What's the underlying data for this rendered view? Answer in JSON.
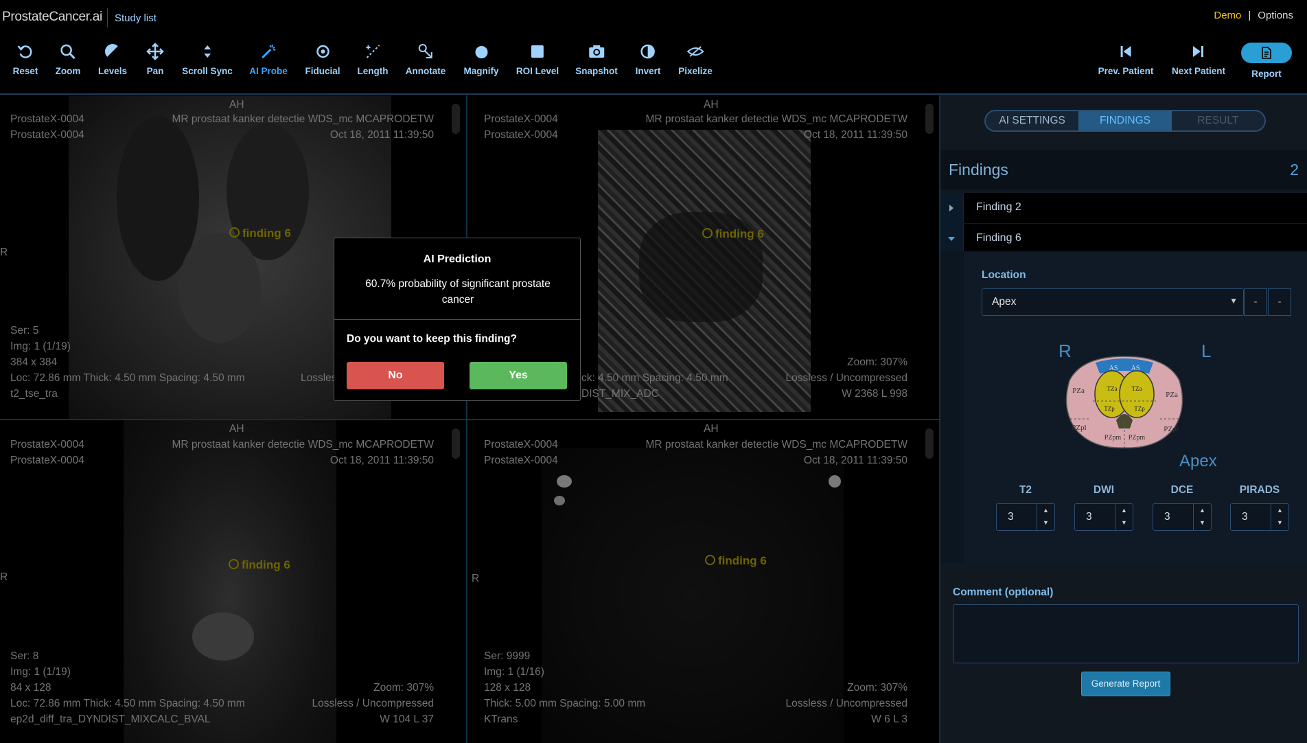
{
  "header": {
    "brand": "ProstateCancer.ai",
    "study_list": "Study list",
    "demo": "Demo",
    "separator": "|",
    "options": "Options"
  },
  "toolbar": {
    "reset": "Reset",
    "zoom": "Zoom",
    "levels": "Levels",
    "pan": "Pan",
    "scroll_sync": "Scroll Sync",
    "ai_probe": "AI Probe",
    "fiducial": "Fiducial",
    "length": "Length",
    "annotate": "Annotate",
    "magnify": "Magnify",
    "roi_level": "ROI Level",
    "snapshot": "Snapshot",
    "invert": "Invert",
    "pixelize": "Pixelize",
    "prev_patient": "Prev. Patient",
    "next_patient": "Next Patient",
    "report": "Report"
  },
  "viewports": {
    "v1": {
      "orient_top": "AH",
      "orient_left": "R",
      "patient_1": "ProstateX-0004",
      "patient_2": "ProstateX-0004",
      "study": "MR prostaat kanker detectie WDS_mc MCAPRODETW",
      "date": "Oct 18, 2011 11:39:50",
      "ser": "Ser: 5",
      "img": "Img: 1 (1/19)",
      "dims": "384 x 384",
      "loc": "Loc: 72.86 mm Thick: 4.50 mm Spacing: 4.50 mm",
      "desc": "t2_tse_tra",
      "lossless": "Lossless / Uncompressed",
      "finding": "finding 6"
    },
    "v2": {
      "orient_top": "AH",
      "patient_1": "ProstateX-0004",
      "patient_2": "ProstateX-0004",
      "study": "MR prostaat kanker detectie WDS_mc MCAPRODETW",
      "date": "Oct 18, 2011 11:39:50",
      "thick": "ck: 4.50 mm Spacing: 4.50 mm",
      "desc": "DIST_MIX_ADC",
      "zoom": "Zoom: 307%",
      "lossless": "Lossless / Uncompressed",
      "wl": "W 2368 L 998",
      "finding": "finding 6"
    },
    "v3": {
      "orient_top": "AH",
      "orient_left": "R",
      "patient_1": "ProstateX-0004",
      "patient_2": "ProstateX-0004",
      "study": "MR prostaat kanker detectie WDS_mc MCAPRODETW",
      "date": "Oct 18, 2011 11:39:50",
      "ser": "Ser: 8",
      "img": "Img: 1 (1/19)",
      "dims": "84 x 128",
      "loc": "Loc: 72.86 mm Thick: 4.50 mm Spacing: 4.50 mm",
      "desc": "ep2d_diff_tra_DYNDIST_MIXCALC_BVAL",
      "zoom": "Zoom: 307%",
      "lossless": "Lossless / Uncompressed",
      "wl": "W 104 L 37",
      "finding": "finding 6"
    },
    "v4": {
      "orient_top": "AH",
      "orient_left": "R",
      "patient_1": "ProstateX-0004",
      "patient_2": "ProstateX-0004",
      "study": "MR prostaat kanker detectie WDS_mc MCAPRODETW",
      "date": "Oct 18, 2011 11:39:50",
      "ser": "Ser: 9999",
      "img": "Img: 1 (1/16)",
      "dims": "128 x 128",
      "thick": "Thick: 5.00 mm Spacing: 5.00 mm",
      "desc": "KTrans",
      "zoom": "Zoom: 307%",
      "lossless": "Lossless / Uncompressed",
      "wl": "W 6 L 3",
      "finding": "finding 6"
    }
  },
  "modal": {
    "title": "AI Prediction",
    "message": "60.7% probability of significant prostate cancer",
    "question": "Do you want to keep this finding?",
    "no": "No",
    "yes": "Yes"
  },
  "panel": {
    "tabs": {
      "ai_settings": "AI SETTINGS",
      "findings": "FINDINGS",
      "result": "RESULT"
    },
    "findings_title": "Findings",
    "findings_count": "2",
    "finding_2": "Finding 2",
    "finding_6": "Finding 6",
    "location_label": "Location",
    "location_value": "Apex",
    "minus": "-",
    "map": {
      "R": "R",
      "L": "L",
      "label": "Apex",
      "zones": {
        "as_l": "AS",
        "as_r": "AS",
        "tza_l": "TZa",
        "tza_r": "TZa",
        "tzp_l": "TZp",
        "tzp_r": "TZp",
        "pza_l": "PZa",
        "pza_r": "PZa",
        "pzpl_l": "PZpl",
        "pzpl_r": "PZpl",
        "pzpm_l": "PZpm",
        "pzpm_r": "PZpm"
      }
    },
    "scores": {
      "t2_label": "T2",
      "t2": "3",
      "dwi_label": "DWI",
      "dwi": "3",
      "dce_label": "DCE",
      "dce": "3",
      "pirads_label": "PIRADS",
      "pirads": "3"
    },
    "comment_label": "Comment (optional)",
    "generate_report": "Generate Report"
  },
  "colors": {
    "accent": "#2a9fd6",
    "finding": "#c8b600",
    "no_button": "#d9534f",
    "yes_button": "#5cb85c"
  }
}
